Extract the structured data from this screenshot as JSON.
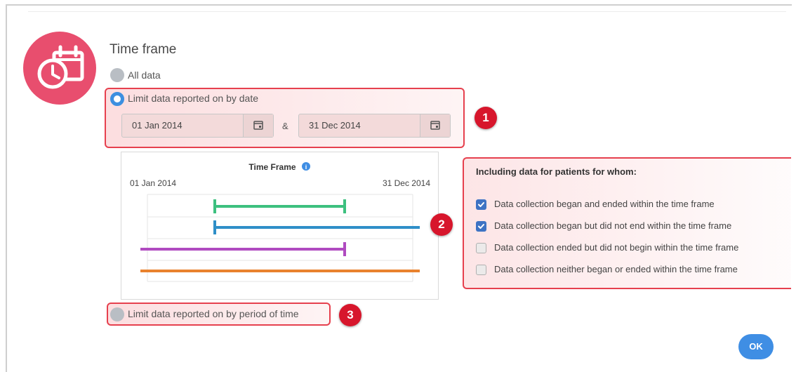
{
  "dialog": {
    "title": "Time frame"
  },
  "options": {
    "all_data": "All data",
    "limit_by_date": "Limit data reported on by date",
    "limit_by_period": "Limit data reported on by period of time"
  },
  "date_range": {
    "start": "01 Jan 2014",
    "separator": "&",
    "end": "31 Dec 2014"
  },
  "callouts": [
    "1",
    "2",
    "3"
  ],
  "chart": {
    "title": "Time Frame",
    "start_label": "01 Jan 2014",
    "end_label": "31 Dec 2014",
    "info_icon": "info-circle-icon"
  },
  "chart_data": {
    "type": "line",
    "title": "Time Frame",
    "xlabel": "",
    "ylabel": "",
    "x_range": [
      "01 Jan 2014",
      "31 Dec 2014"
    ],
    "extends": [
      "before-start",
      "after-end"
    ],
    "series": [
      {
        "color": "#3dc07f",
        "start": "within",
        "end": "within"
      },
      {
        "color": "#2f8fc8",
        "start": "within",
        "end": "after-end"
      },
      {
        "color": "#b04bc0",
        "start": "before-start",
        "end": "within"
      },
      {
        "color": "#e9822e",
        "start": "before-start",
        "end": "after-end"
      }
    ]
  },
  "filters": {
    "heading": "Including data for patients for whom:",
    "items": [
      {
        "label": "Data collection began and ended within the time frame",
        "checked": true
      },
      {
        "label": "Data collection began but did not end within the time frame",
        "checked": true
      },
      {
        "label": "Data collection ended but did not begin within the time frame",
        "checked": false
      },
      {
        "label": "Data collection neither began or ended within the time frame",
        "checked": false
      }
    ]
  },
  "actions": {
    "ok": "OK"
  },
  "colors": {
    "accent": "#3d8fe0",
    "brand": "#e84e6e",
    "callout": "#d7162c"
  }
}
